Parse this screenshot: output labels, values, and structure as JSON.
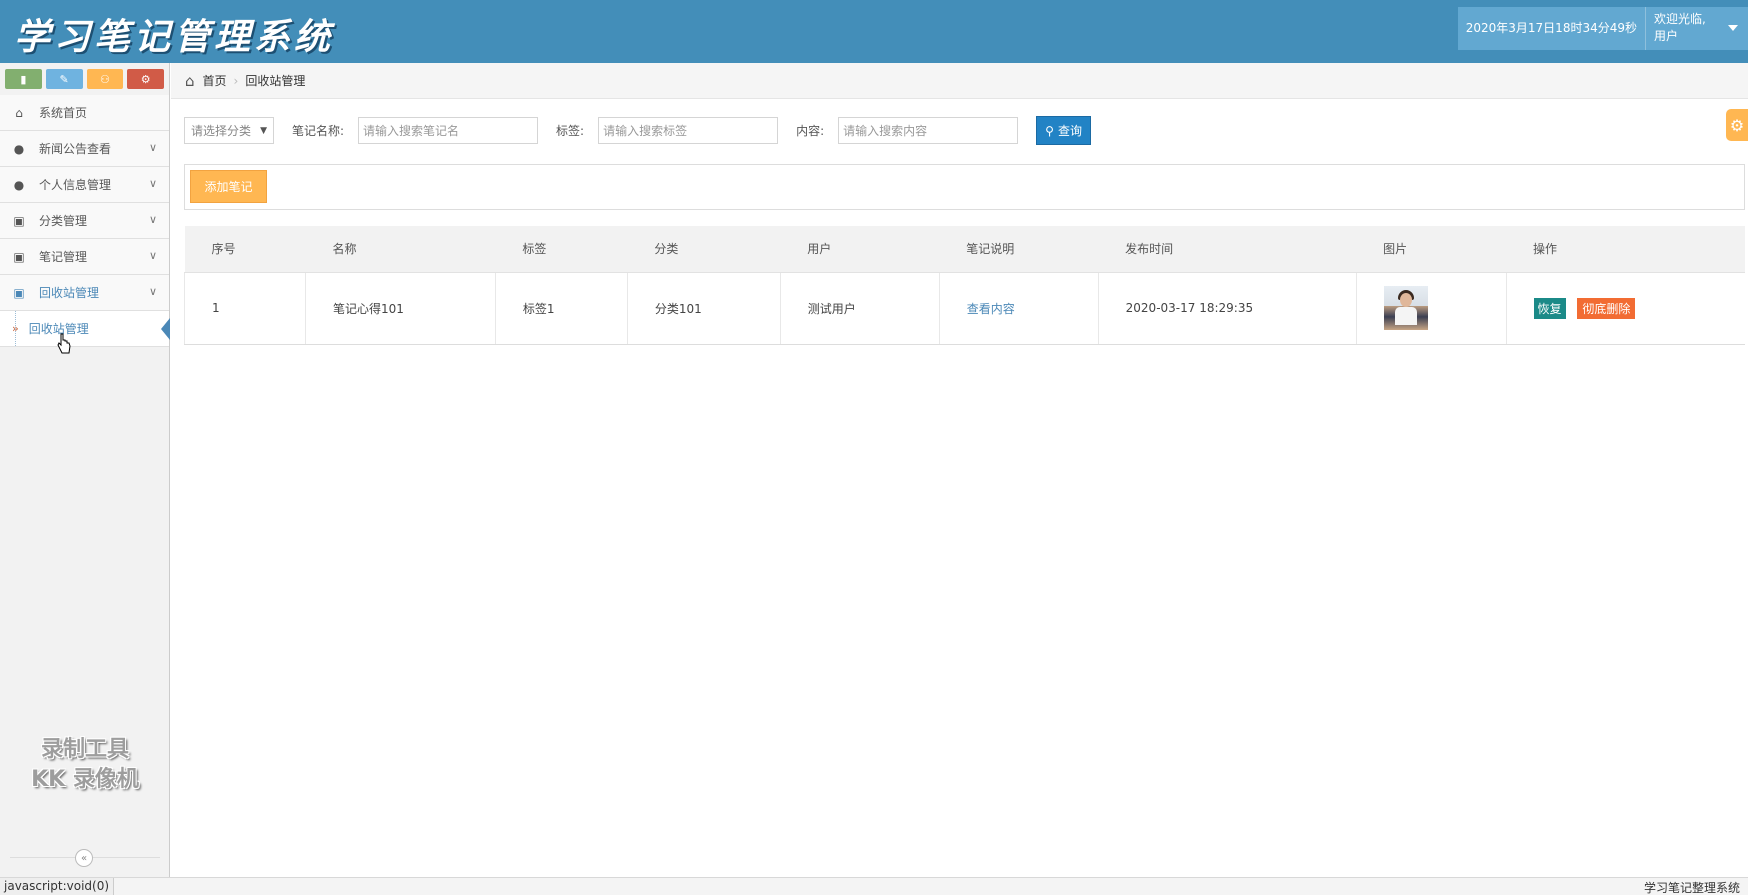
{
  "header": {
    "logo": "学习笔记管理系统",
    "datetime": "2020年3月17日18时34分49秒",
    "welcome": "欢迎光临,",
    "username": "用户"
  },
  "sidebar": {
    "items": [
      {
        "label": "系统首页",
        "icon": "home-icon"
      },
      {
        "label": "新闻公告查看",
        "icon": "user-icon"
      },
      {
        "label": "个人信息管理",
        "icon": "user-icon"
      },
      {
        "label": "分类管理",
        "icon": "picture-icon"
      },
      {
        "label": "笔记管理",
        "icon": "picture-icon"
      },
      {
        "label": "回收站管理",
        "icon": "picture-icon"
      }
    ],
    "sub_item": "回收站管理",
    "watermark_line1": "录制工具",
    "watermark_line2": "KK 录像机"
  },
  "breadcrumb": {
    "home": "首页",
    "current": "回收站管理"
  },
  "search": {
    "category_placeholder": "请选择分类",
    "name_label": "笔记名称:",
    "name_placeholder": "请输入搜索笔记名",
    "tag_label": "标签:",
    "tag_placeholder": "请输入搜索标签",
    "content_label": "内容:",
    "content_placeholder": "请输入搜索内容",
    "query_button": "查询"
  },
  "toolbar": {
    "add_button": "添加笔记"
  },
  "table": {
    "headers": [
      "序号",
      "名称",
      "标签",
      "分类",
      "用户",
      "笔记说明",
      "发布时间",
      "图片",
      "操作"
    ],
    "rows": [
      {
        "index": "1",
        "name": "笔记心得101",
        "tag": "标签1",
        "category": "分类101",
        "user": "测试用户",
        "description": "查看内容",
        "published": "2020-03-17 18:29:35",
        "restore": "恢复",
        "delete": "彻底删除"
      }
    ]
  },
  "statusbar": {
    "left": "javascript:void(0)",
    "right": "学习笔记整理系统"
  },
  "colors": {
    "header": "#438eb9",
    "primary": "#2283c5",
    "warning": "#ffb752",
    "restore": "#1b8a88",
    "danger": "#f26c33"
  }
}
